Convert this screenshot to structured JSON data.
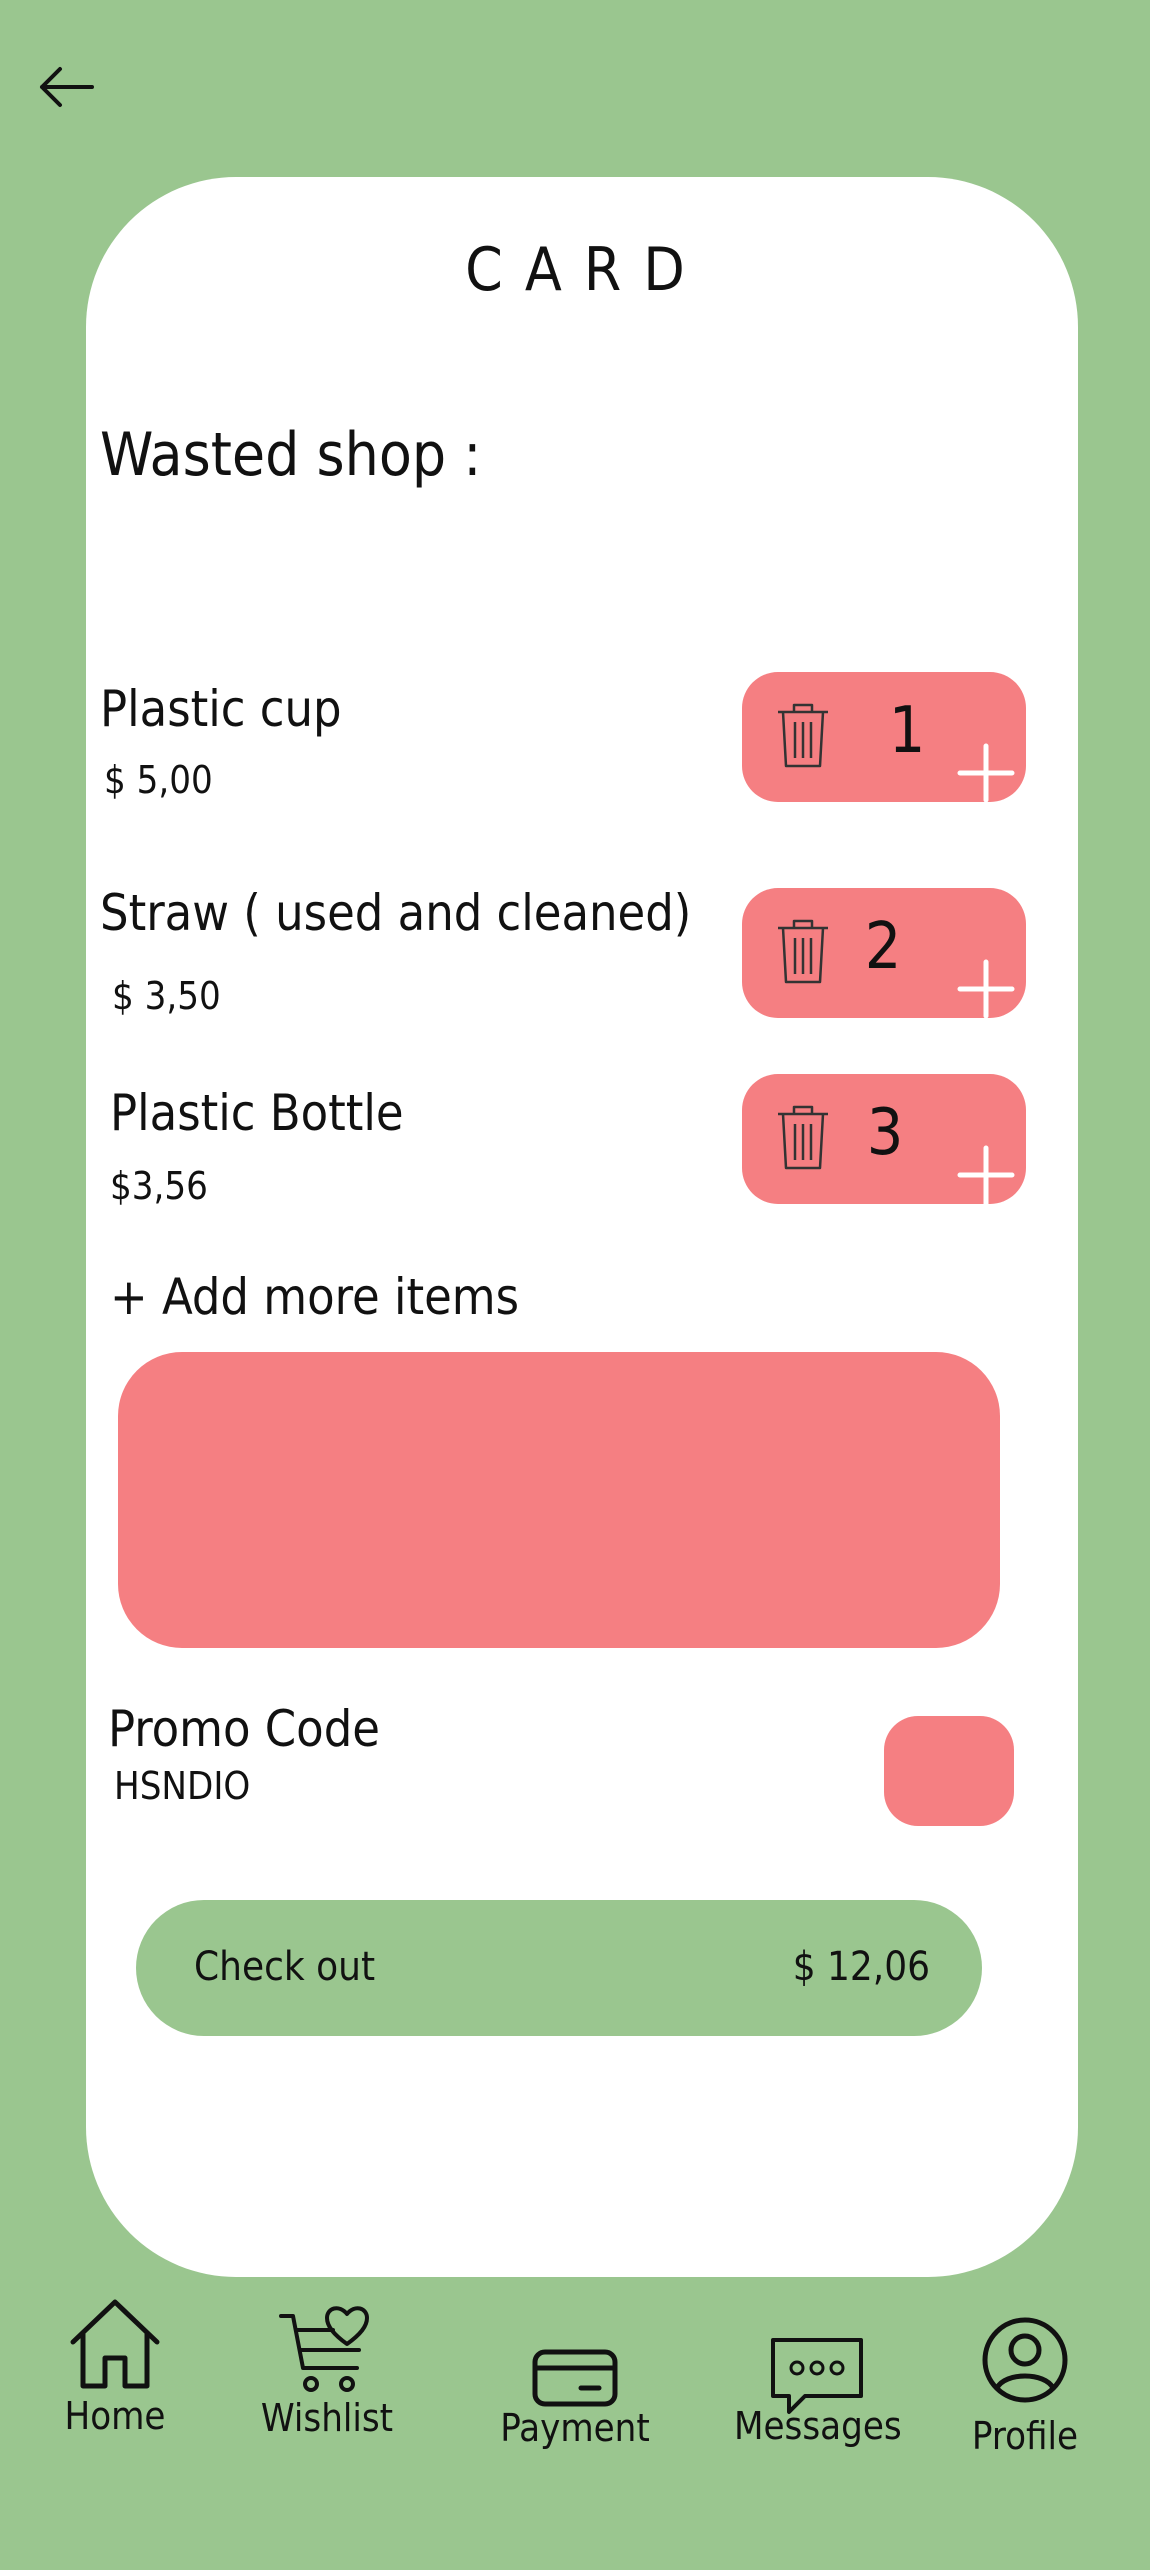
{
  "header": {
    "title": "CARD",
    "back_icon": "arrow-left-icon"
  },
  "shop": {
    "label": "Wasted shop :"
  },
  "items": [
    {
      "name": "Plastic cup",
      "price": "$ 5,00",
      "quantity": "1"
    },
    {
      "name": "Straw ( used and cleaned)",
      "price": "$ 3,50",
      "quantity": "2"
    },
    {
      "name": "Plastic Bottle",
      "price": "$3,56",
      "quantity": "3"
    }
  ],
  "add_more": {
    "label": "+ Add more items"
  },
  "promo": {
    "label": "Promo Code",
    "code": "HSNDIO"
  },
  "checkout": {
    "label": "Check out",
    "total": "$ 12,06"
  },
  "nav": [
    {
      "label": "Home",
      "icon": "home-icon"
    },
    {
      "label": "Wishlist",
      "icon": "cart-heart-icon"
    },
    {
      "label": "Payment",
      "icon": "credit-card-icon"
    },
    {
      "label": "Messages",
      "icon": "chat-bubble-icon"
    },
    {
      "label": "Profile",
      "icon": "user-circle-icon"
    }
  ],
  "colors": {
    "background": "#9ac68f",
    "accent": "#f57f82",
    "card": "#ffffff"
  }
}
